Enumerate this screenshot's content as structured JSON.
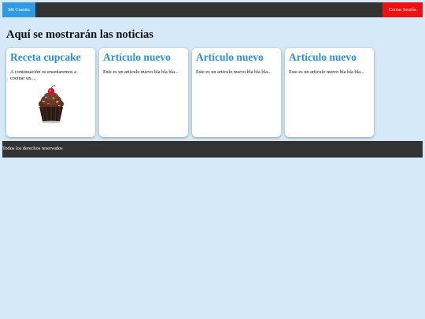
{
  "nav": {
    "account_label": "Mi Cuenta",
    "logout_label": "Cerrar Sesión",
    "colors": {
      "bar": "#333333",
      "account": "#2f9be5",
      "logout": "#f10f0f"
    }
  },
  "main": {
    "heading": "Aquí se mostrarán las noticias",
    "cards": [
      {
        "title": "Receta cupcake",
        "text": "A continuación os enseñaremos a cocinar un....",
        "icon": "cupcake-image"
      },
      {
        "title": "Artículo nuevo",
        "text": "Este es un articulo nuevo bla bla bla..."
      },
      {
        "title": "Artículo nuevo",
        "text": "Este es un articulo nuevo bla bla bla..."
      },
      {
        "title": "Artículo nuevo",
        "text": "Este es un articulo nuevo bla bla bla..."
      }
    ],
    "accent_color": "#2b8fd5"
  },
  "footer": {
    "text": "Todos los derechos reservados"
  }
}
